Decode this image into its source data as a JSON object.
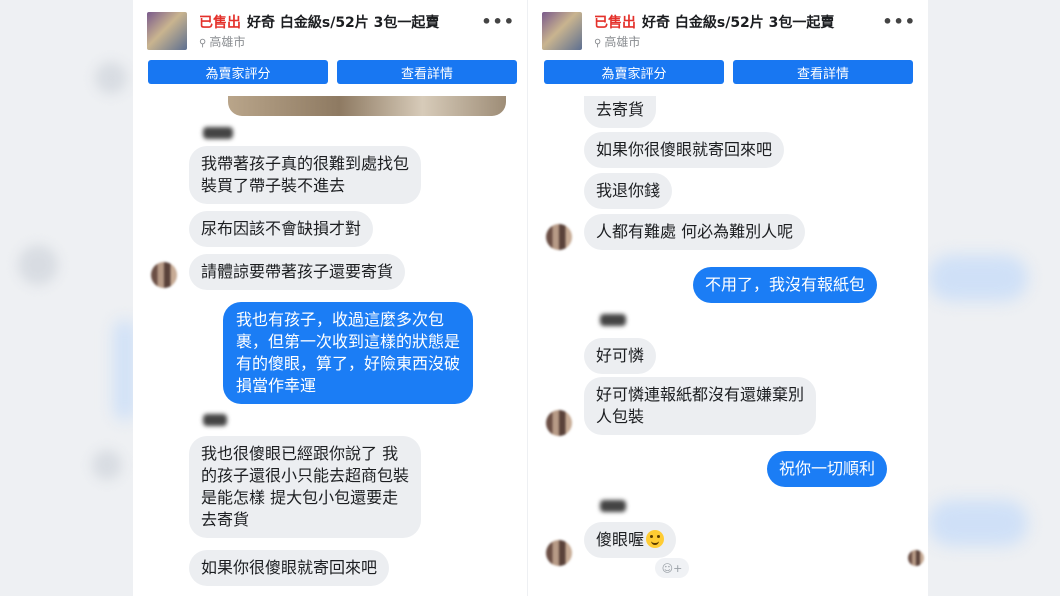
{
  "listing": {
    "sold_label": "已售出",
    "title": "好奇 白金級s/52片 3包一起賣",
    "location": "高雄市",
    "more_label": "•••",
    "rate_seller_label": "為賣家評分",
    "view_details_label": "查看詳情"
  },
  "left_chat": {
    "m1": "我帶著孩子真的很難到處找包\n裝買了帶子裝不進去",
    "m2": "尿布因該不會缺損才對",
    "m3": "請體諒要帶著孩子還要寄貨",
    "m4": "我也有孩子，收過這麼多次包\n裹，但第一次收到這樣的狀態是\n有的傻眼，算了，好險東西沒破\n損當作幸運",
    "m5": "我也很傻眼已經跟你說了 我\n的孩子還很小只能去超商包裝\n是能怎樣 提大包小包還要走\n去寄貨",
    "m6": "如果你很傻眼就寄回來吧"
  },
  "right_chat": {
    "m1": "去寄貨",
    "m2": "如果你很傻眼就寄回來吧",
    "m3": "我退你錢",
    "m4": "人都有難處 何必為難別人呢",
    "m5": "不用了，我沒有報紙包",
    "m6": "好可憐",
    "m7": "好可憐連報紙都沒有還嫌棄別\n人包裝",
    "m8": "祝你一切順利",
    "m9": "傻眼喔"
  }
}
